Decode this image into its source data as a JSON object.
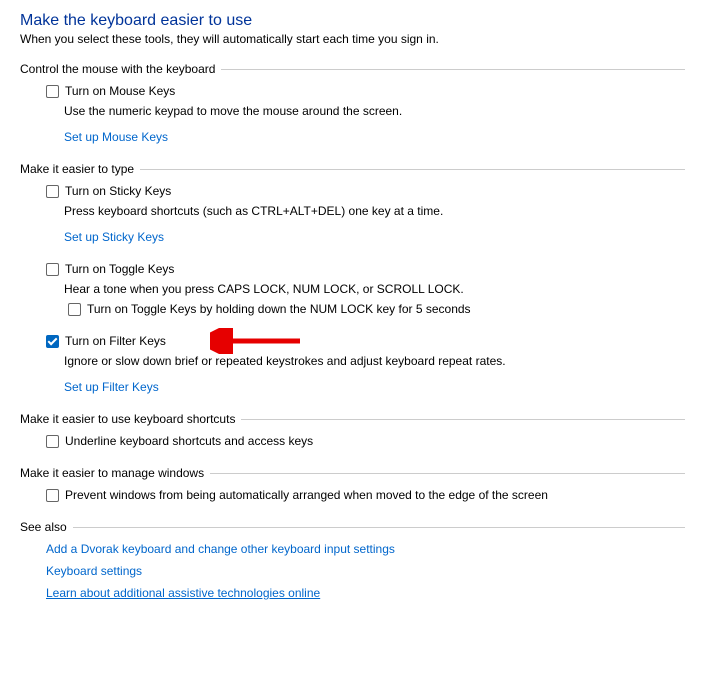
{
  "header": {
    "title": "Make the keyboard easier to use",
    "subtitle": "When you select these tools, they will automatically start each time you sign in."
  },
  "sections": {
    "mouse": {
      "title": "Control the mouse with the keyboard",
      "mouse_keys_label": "Turn on Mouse Keys",
      "mouse_keys_desc": "Use the numeric keypad to move the mouse around the screen.",
      "mouse_keys_link": "Set up Mouse Keys"
    },
    "type": {
      "title": "Make it easier to type",
      "sticky_label": "Turn on Sticky Keys",
      "sticky_desc": "Press keyboard shortcuts (such as CTRL+ALT+DEL) one key at a time.",
      "sticky_link": "Set up Sticky Keys",
      "toggle_label": "Turn on Toggle Keys",
      "toggle_desc": "Hear a tone when you press CAPS LOCK, NUM LOCK, or SCROLL LOCK.",
      "toggle_hold_label": "Turn on Toggle Keys by holding down the NUM LOCK key for 5 seconds",
      "filter_label": "Turn on Filter Keys",
      "filter_desc": "Ignore or slow down brief or repeated keystrokes and adjust keyboard repeat rates.",
      "filter_link": "Set up Filter Keys"
    },
    "shortcuts": {
      "title": "Make it easier to use keyboard shortcuts",
      "underline_label": "Underline keyboard shortcuts and access keys"
    },
    "windows": {
      "title": "Make it easier to manage windows",
      "prevent_label": "Prevent windows from being automatically arranged when moved to the edge of the screen"
    },
    "seealso": {
      "title": "See also",
      "link1": "Add a Dvorak keyboard and change other keyboard input settings",
      "link2": "Keyboard settings",
      "link3": "Learn about additional assistive technologies online"
    }
  },
  "state": {
    "mouse_keys_checked": false,
    "sticky_checked": false,
    "toggle_checked": false,
    "toggle_hold_checked": false,
    "filter_checked": true,
    "underline_checked": false,
    "prevent_checked": false
  },
  "annotation": {
    "arrow_color": "#e60000"
  }
}
